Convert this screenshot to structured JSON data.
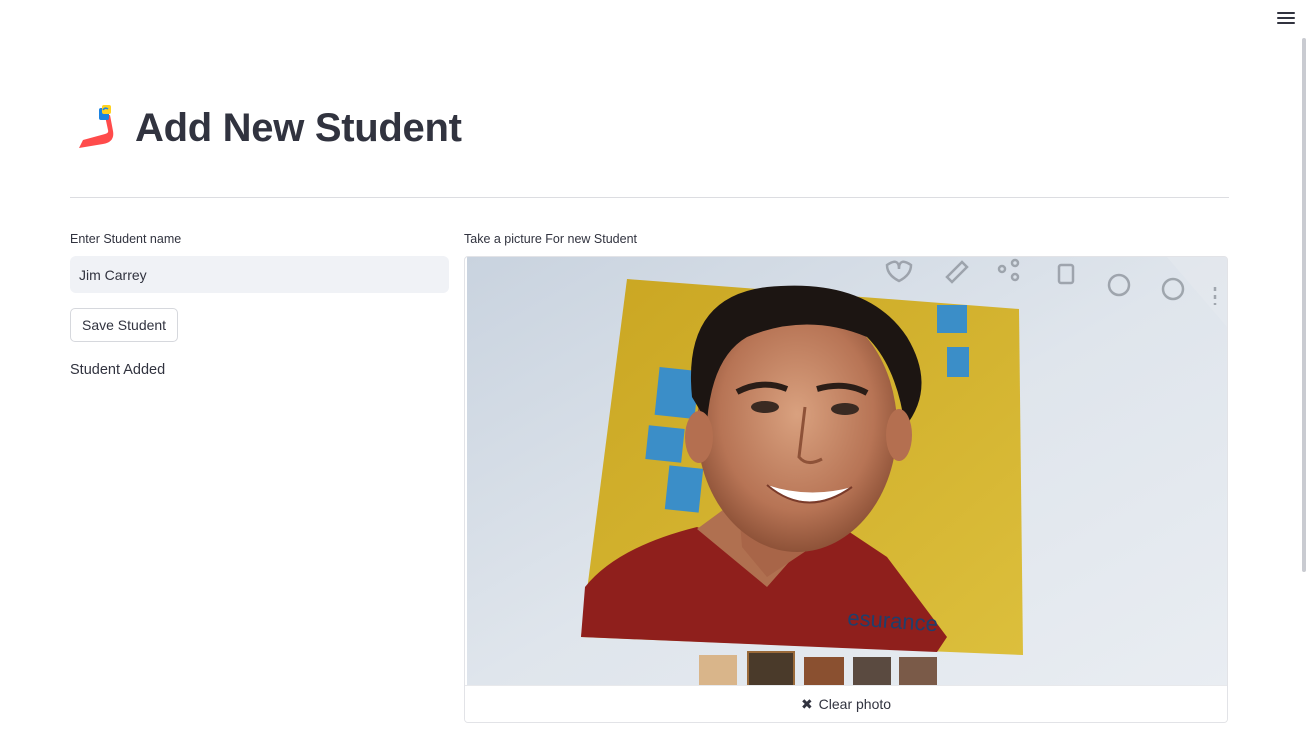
{
  "header": {
    "title": "Add New Student",
    "logo_icon": "streamlit-style-logo-icon"
  },
  "menu": {
    "icon": "hamburger-menu-icon"
  },
  "form": {
    "name_label": "Enter Student name",
    "name_value": "Jim Carrey",
    "save_label": "Save Student",
    "status": "Student Added"
  },
  "camera": {
    "label": "Take a picture For new Student",
    "clear_label": "Clear photo",
    "clear_icon": "close-icon"
  },
  "colors": {
    "text": "#31333f",
    "input_bg": "#f0f2f6",
    "logo_red": "#ff4b4b",
    "logo_blue": "#1c83e1",
    "logo_yellow": "#ffd21f"
  }
}
